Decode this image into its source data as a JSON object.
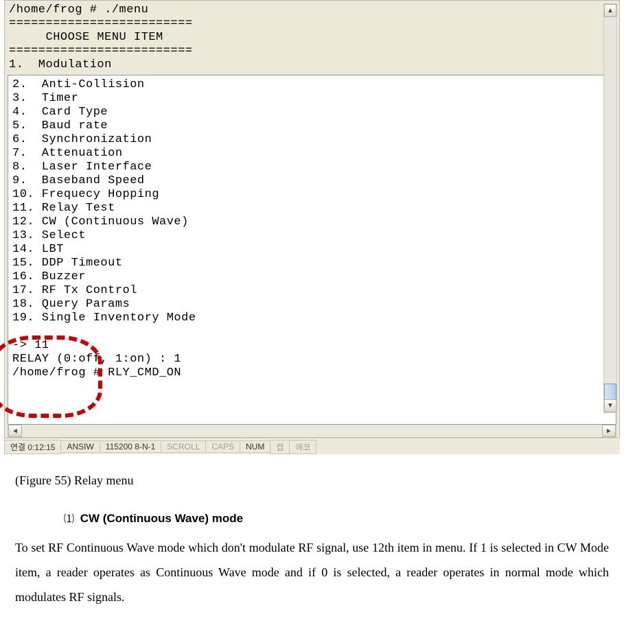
{
  "terminal_top": "/home/frog # ./menu\n=========================\n     CHOOSE MENU ITEM\n=========================\n1.  Modulation",
  "terminal_inner": "2.  Anti-Collision\n3.  Timer\n4.  Card Type\n5.  Baud rate\n6.  Synchronization\n7.  Attenuation\n8.  Laser Interface\n9.  Baseband Speed\n10. Frequecy Hopping\n11. Relay Test\n12. CW (Continuous Wave)\n13. Select\n14. LBT\n15. DDP Timeout\n16. Buzzer\n17. RF Tx Control\n18. Query Params\n19. Single Inventory Mode\n\n-> 11\nRELAY (0:off, 1:on) : 1\n/home/frog # RLY_CMD_ON",
  "status": {
    "conn": "연결 0:12:15",
    "term": "ANSIW",
    "line": "115200 8-N-1",
    "scroll": "SCROLL",
    "caps": "CAPS",
    "num": "NUM",
    "cap": "캡",
    "echo": "에코"
  },
  "caption": "(Figure 55) Relay menu",
  "section": {
    "num": "⑴",
    "title": "CW (Continuous Wave) mode"
  },
  "body": "To set RF Continuous Wave mode which don't modulate RF signal, use 12th item in menu. If 1 is selected in CW Mode item, a reader operates as Continuous Wave mode and if 0 is selected, a reader operates in normal mode which modulates RF signals."
}
